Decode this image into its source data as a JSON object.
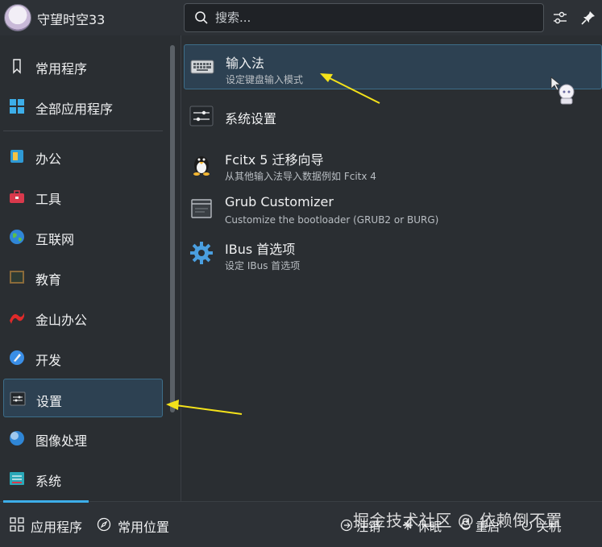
{
  "header": {
    "username": "守望时空33",
    "search_placeholder": "搜索..."
  },
  "sidebar": {
    "items": [
      {
        "label": "常用程序",
        "icon": "bookmark-icon"
      },
      {
        "label": "全部应用程序",
        "icon": "grid-icon"
      },
      {
        "label": "办公",
        "icon": "office-icon"
      },
      {
        "label": "工具",
        "icon": "toolbox-icon"
      },
      {
        "label": "互联网",
        "icon": "globe-icon"
      },
      {
        "label": "教育",
        "icon": "chalkboard-icon"
      },
      {
        "label": "金山办公",
        "icon": "wps-icon"
      },
      {
        "label": "开发",
        "icon": "development-icon"
      },
      {
        "label": "设置",
        "icon": "settings-icon"
      },
      {
        "label": "图像处理",
        "icon": "graphics-icon"
      },
      {
        "label": "系统",
        "icon": "system-icon"
      }
    ],
    "selected_index": 8
  },
  "apps": [
    {
      "name": "输入法",
      "desc": "设定键盘输入模式",
      "icon": "keyboard-icon"
    },
    {
      "name": "系统设置",
      "desc": "",
      "icon": "system-settings-icon"
    },
    {
      "name": "Fcitx 5 迁移向导",
      "desc": "从其他输入法导入数据例如 Fcitx 4",
      "icon": "penguin-icon"
    },
    {
      "name": "Grub Customizer",
      "desc": "Customize the bootloader (GRUB2 or BURG)",
      "icon": "window-icon"
    },
    {
      "name": "IBus 首选项",
      "desc": "设定 IBus 首选项",
      "icon": "gear-icon"
    }
  ],
  "footer": {
    "tabs": [
      {
        "label": "应用程序",
        "icon": "grid-icon"
      },
      {
        "label": "常用位置",
        "icon": "compass-icon"
      }
    ],
    "power": [
      {
        "label": "注销",
        "icon": "logout-icon"
      },
      {
        "label": "休眠",
        "icon": "sleep-icon"
      },
      {
        "label": "重启",
        "icon": "restart-icon"
      },
      {
        "label": "关机",
        "icon": "shutdown-icon"
      }
    ],
    "watermark": "掘金技术社区 @ 依赖倒不置"
  },
  "colors": {
    "background": "#2a2e32",
    "selection": "#2d4152",
    "selection_border": "#3d6e8a",
    "accent": "#3daee9",
    "annotation_arrow": "#f4e21a"
  }
}
